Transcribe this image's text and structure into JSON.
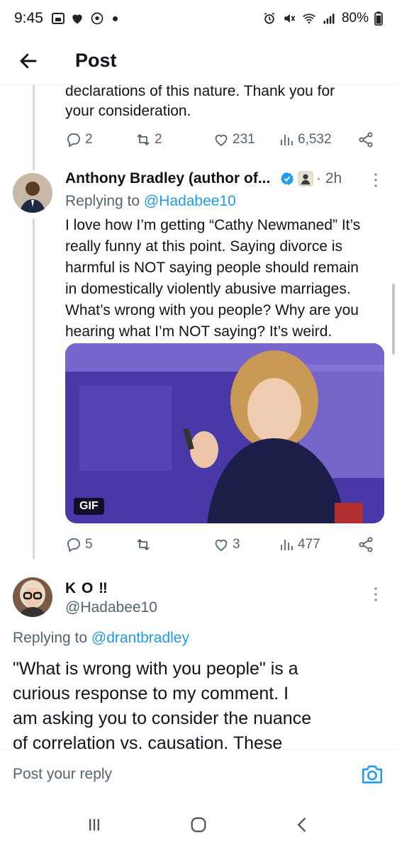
{
  "status_bar": {
    "time": "9:45",
    "battery": "80%",
    "icons": [
      "gallery-icon",
      "heart-icon",
      "soccer-ball-icon",
      "dot-icon",
      "alarm-icon",
      "mute-icon",
      "wifi-icon",
      "signal-icon",
      "battery-icon"
    ]
  },
  "header": {
    "back_icon": "arrow-left-icon",
    "title": "Post"
  },
  "prev_post": {
    "text_line1": "declarations of this nature.  Thank you for",
    "text_line2": "your consideration.",
    "actions": {
      "replies": "2",
      "reposts": "2",
      "likes": "231",
      "views": "6,532"
    }
  },
  "reply_post": {
    "author_name": "Anthony Bradley (author of...",
    "verified": true,
    "time": "2h",
    "replying_label": "Replying to",
    "replying_to": "@Hadabee10",
    "body_lines": [
      "I love how I’m getting “Cathy Newmaned” It’s",
      "really funny at this point. Saying divorce is",
      "harmful is NOT saying people should remain",
      "in domestically violently abusive marriages.",
      "What’s wrong with you people? Why are you",
      "hearing what I’m NOT saying? It’s weird."
    ],
    "media_badge": "GIF",
    "actions": {
      "replies": "5",
      "reposts": "",
      "likes": "3",
      "views": "477"
    }
  },
  "focus_post": {
    "author_name": "K O ‼",
    "handle": "@Hadabee10",
    "replying_label": "Replying to",
    "replying_to": "@drantbradley",
    "body_lines": [
      "\"What is wrong with you people\" is a",
      "curious response to my comment.  I",
      "am asking you to consider the nuance",
      "of correlation vs. causation.  These"
    ]
  },
  "reply_bar": {
    "placeholder": "Post your reply"
  },
  "colors": {
    "accent": "#1d9bf0",
    "muted": "#536471",
    "text": "#0f1419",
    "thread_line": "#cfd9de"
  }
}
